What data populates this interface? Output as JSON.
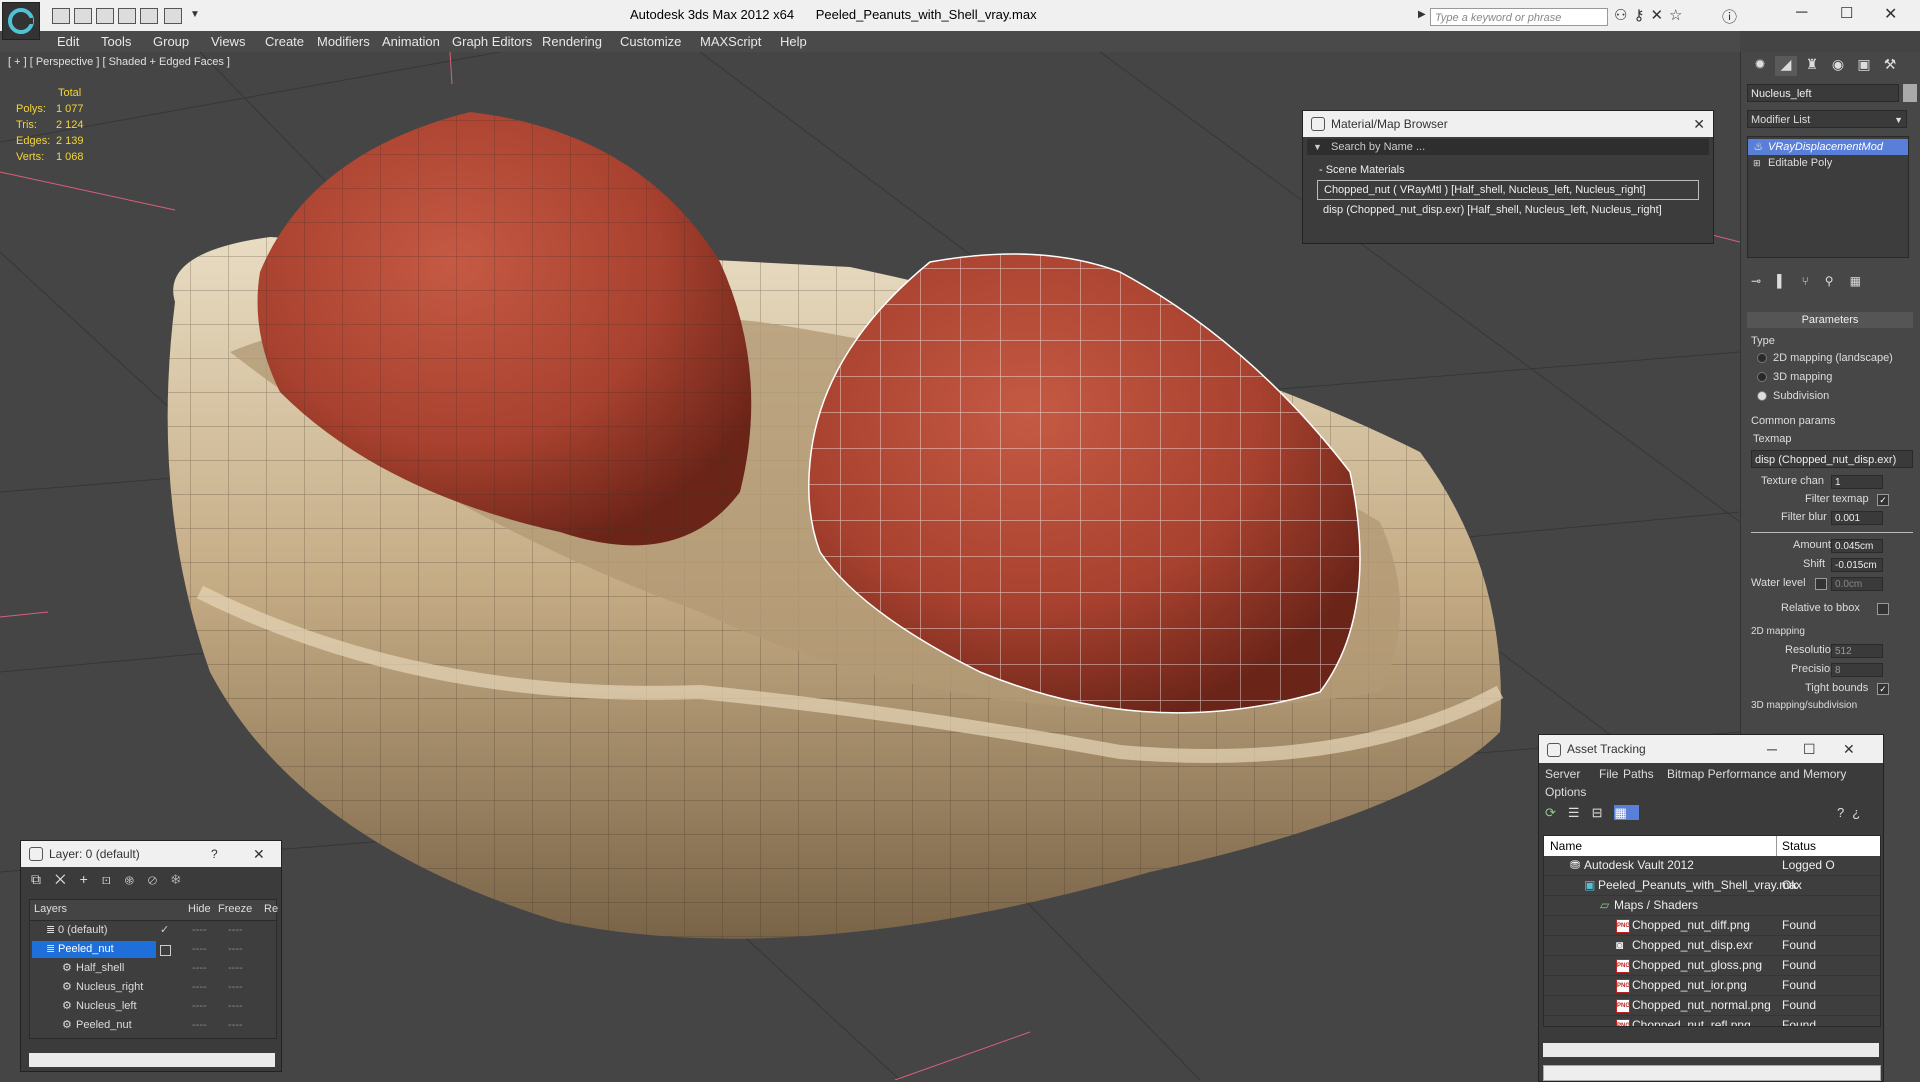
{
  "window": {
    "app_title": "Autodesk 3ds Max  2012 x64",
    "file_title": "Peeled_Peanuts_with_Shell_vray.max",
    "search_placeholder": "Type a keyword or phrase"
  },
  "menu": [
    "Edit",
    "Tools",
    "Group",
    "Views",
    "Create",
    "Modifiers",
    "Animation",
    "Graph Editors",
    "Rendering",
    "Customize",
    "MAXScript",
    "Help"
  ],
  "viewport": {
    "label": "[ + ] [ Perspective ] [ Shaded + Edged Faces ]",
    "stats_header": "Total",
    "stats": [
      {
        "label": "Polys:",
        "value": "1 077"
      },
      {
        "label": "Tris:",
        "value": "2 124"
      },
      {
        "label": "Edges:",
        "value": "2 139"
      },
      {
        "label": "Verts:",
        "value": "1 068"
      }
    ]
  },
  "command_panel": {
    "object_name": "Nucleus_left",
    "modifier_list": "Modifier List",
    "stack": [
      "VRayDisplacementMod",
      "Editable Poly"
    ],
    "params_title": "Parameters",
    "type_label": "Type",
    "types": [
      {
        "label": "2D mapping (landscape)",
        "selected": false
      },
      {
        "label": "3D mapping",
        "selected": false
      },
      {
        "label": "Subdivision",
        "selected": true
      }
    ],
    "common_params": "Common params",
    "texmap_label": "Texmap",
    "texmap_value": "disp (Chopped_nut_disp.exr)",
    "texture_chan_label": "Texture chan",
    "texture_chan": "1",
    "filter_texmap": "Filter texmap",
    "filter_blur_label": "Filter blur",
    "filter_blur": "0.001",
    "amount_label": "Amount",
    "amount": "0.045cm",
    "shift_label": "Shift",
    "shift": "-0.015cm",
    "water_level_label": "Water level",
    "water_level": "0.0cm",
    "relative_bbox": "Relative to bbox",
    "mapping2d": "2D mapping",
    "resolution_label": "Resolution",
    "resolution": "512",
    "precision_label": "Precision",
    "precision": "8",
    "tight_bounds": "Tight bounds",
    "mapping3d": "3D mapping/subdivision"
  },
  "material_browser": {
    "title": "Material/Map Browser",
    "search": "Search by Name ...",
    "section": "- Scene Materials",
    "items": [
      "Chopped_nut  ( VRayMtl ) [Half_shell, Nucleus_left, Nucleus_right]",
      "disp (Chopped_nut_disp.exr) [Half_shell, Nucleus_left, Nucleus_right]"
    ]
  },
  "layer_window": {
    "title": "Layer: 0 (default)",
    "help": "?",
    "columns": [
      "Layers",
      "Hide",
      "Freeze",
      "Re"
    ],
    "rows": [
      {
        "name": "0 (default)",
        "indent": 1
      },
      {
        "name": "Peeled_nut",
        "indent": 1,
        "selected": true
      },
      {
        "name": "Half_shell",
        "indent": 2
      },
      {
        "name": "Nucleus_right",
        "indent": 2
      },
      {
        "name": "Nucleus_left",
        "indent": 2
      },
      {
        "name": "Peeled_nut",
        "indent": 2
      }
    ],
    "dash": "----"
  },
  "asset_tracking": {
    "title": "Asset Tracking",
    "menu": [
      "Server",
      "File",
      "Paths",
      "Bitmap Performance and Memory",
      "Options"
    ],
    "columns": [
      "Name",
      "Status"
    ],
    "rows": [
      {
        "name": "Autodesk Vault 2012",
        "status": "Logged O",
        "indent": 1,
        "icon": "vault"
      },
      {
        "name": "Peeled_Peanuts_with_Shell_vray.max",
        "status": "Ok",
        "indent": 2,
        "icon": "max"
      },
      {
        "name": "Maps / Shaders",
        "status": "",
        "indent": 3,
        "icon": "maps"
      },
      {
        "name": "Chopped_nut_diff.png",
        "status": "Found",
        "indent": 4,
        "icon": "png"
      },
      {
        "name": "Chopped_nut_disp.exr",
        "status": "Found",
        "indent": 4,
        "icon": "exr"
      },
      {
        "name": "Chopped_nut_gloss.png",
        "status": "Found",
        "indent": 4,
        "icon": "png"
      },
      {
        "name": "Chopped_nut_ior.png",
        "status": "Found",
        "indent": 4,
        "icon": "png"
      },
      {
        "name": "Chopped_nut_normal.png",
        "status": "Found",
        "indent": 4,
        "icon": "png"
      },
      {
        "name": "Chopped_nut_refl.png",
        "status": "Found",
        "indent": 4,
        "icon": "png"
      }
    ]
  }
}
